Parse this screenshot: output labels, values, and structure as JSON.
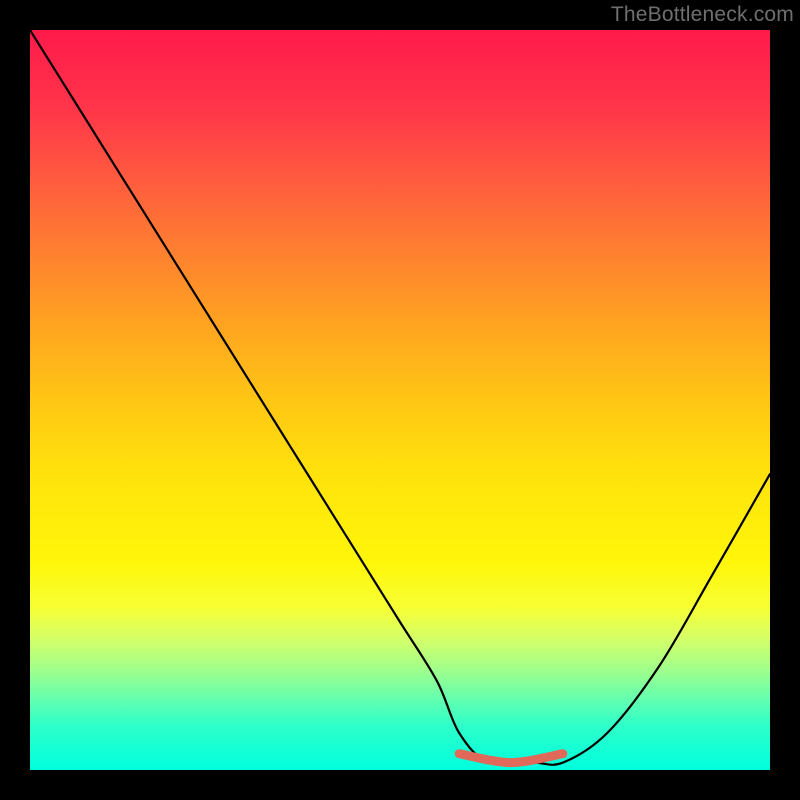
{
  "watermark": "TheBottleneck.com",
  "chart_data": {
    "type": "line",
    "title": "",
    "xlabel": "",
    "ylabel": "",
    "xlim": [
      0,
      100
    ],
    "ylim": [
      0,
      100
    ],
    "series": [
      {
        "name": "bottleneck-curve",
        "x": [
          0,
          5,
          10,
          15,
          20,
          25,
          30,
          35,
          40,
          45,
          50,
          55,
          58,
          62,
          68,
          72,
          78,
          85,
          92,
          100
        ],
        "y": [
          100,
          92,
          84,
          76,
          68,
          60,
          52,
          44,
          36,
          28,
          20,
          12,
          5,
          1,
          1,
          1,
          5,
          14,
          26,
          40
        ]
      },
      {
        "name": "optimal-range-marker",
        "x": [
          58,
          72
        ],
        "y": [
          1,
          1
        ]
      }
    ],
    "colors": {
      "curve": "#000000",
      "marker": "#e0695a",
      "gradient_top": "#ff1a4a",
      "gradient_bottom": "#00ffde"
    }
  }
}
